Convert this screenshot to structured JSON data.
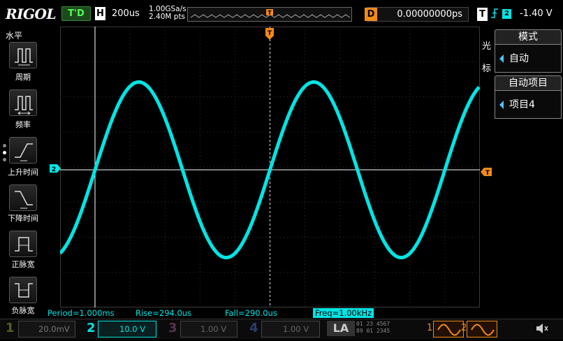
{
  "top": {
    "logo": "RIGOL",
    "run_state": "T'D",
    "h_label": "H",
    "timebase": "200us",
    "sample_rate": "1.00GSa/s",
    "mem_depth": "2.40M pts",
    "d_label": "D",
    "delay": "0.00000000ps",
    "t_label": "T",
    "trigger_channel": "2",
    "trigger_level": "-1.40 V"
  },
  "left_menu": {
    "title": "水平",
    "items": [
      {
        "label": "周期",
        "icon": "period-icon"
      },
      {
        "label": "频率",
        "icon": "frequency-icon"
      },
      {
        "label": "上升时间",
        "icon": "rise-time-icon"
      },
      {
        "label": "下降时间",
        "icon": "fall-time-icon"
      },
      {
        "label": "正脉宽",
        "icon": "positive-pulse-width-icon"
      },
      {
        "label": "负脉宽",
        "icon": "negative-pulse-width-icon"
      }
    ]
  },
  "right_menu": {
    "side_label_1": "光",
    "side_label_2": "标",
    "mode_title": "模式",
    "mode_value": "自动",
    "auto_item_title": "自动项目",
    "auto_item_value": "项目4"
  },
  "measurements": {
    "period": "Period=1.000ms",
    "rise": "Rise=294.0us",
    "fall": "Fall=290.0us",
    "freq": "Freq=1.00kHz"
  },
  "channels": [
    {
      "num": "1",
      "scale": "20.0mV",
      "color": "#d8d800",
      "active": false
    },
    {
      "num": "2",
      "scale": "10.0 V",
      "color": "#00e5e5",
      "active": true
    },
    {
      "num": "3",
      "scale": "1.00 V",
      "color": "#d050d0",
      "active": false
    },
    {
      "num": "4",
      "scale": "1.00 V",
      "color": "#3a6ee0",
      "active": false
    }
  ],
  "la": {
    "label": "LA",
    "row1": "01 23 4567",
    "row2": "89 01 2345"
  },
  "refs": [
    {
      "num": "1"
    },
    {
      "num": "2"
    }
  ],
  "markers": {
    "ch2_marker": "2",
    "trigger_marker": "T",
    "trigger_pos_marker": "T"
  },
  "waveform": {
    "type": "sine",
    "color": "#00e5e5",
    "period_divs": 5,
    "amplitude_divs": 2.5,
    "phase": "rising zero-cross at trigger"
  }
}
